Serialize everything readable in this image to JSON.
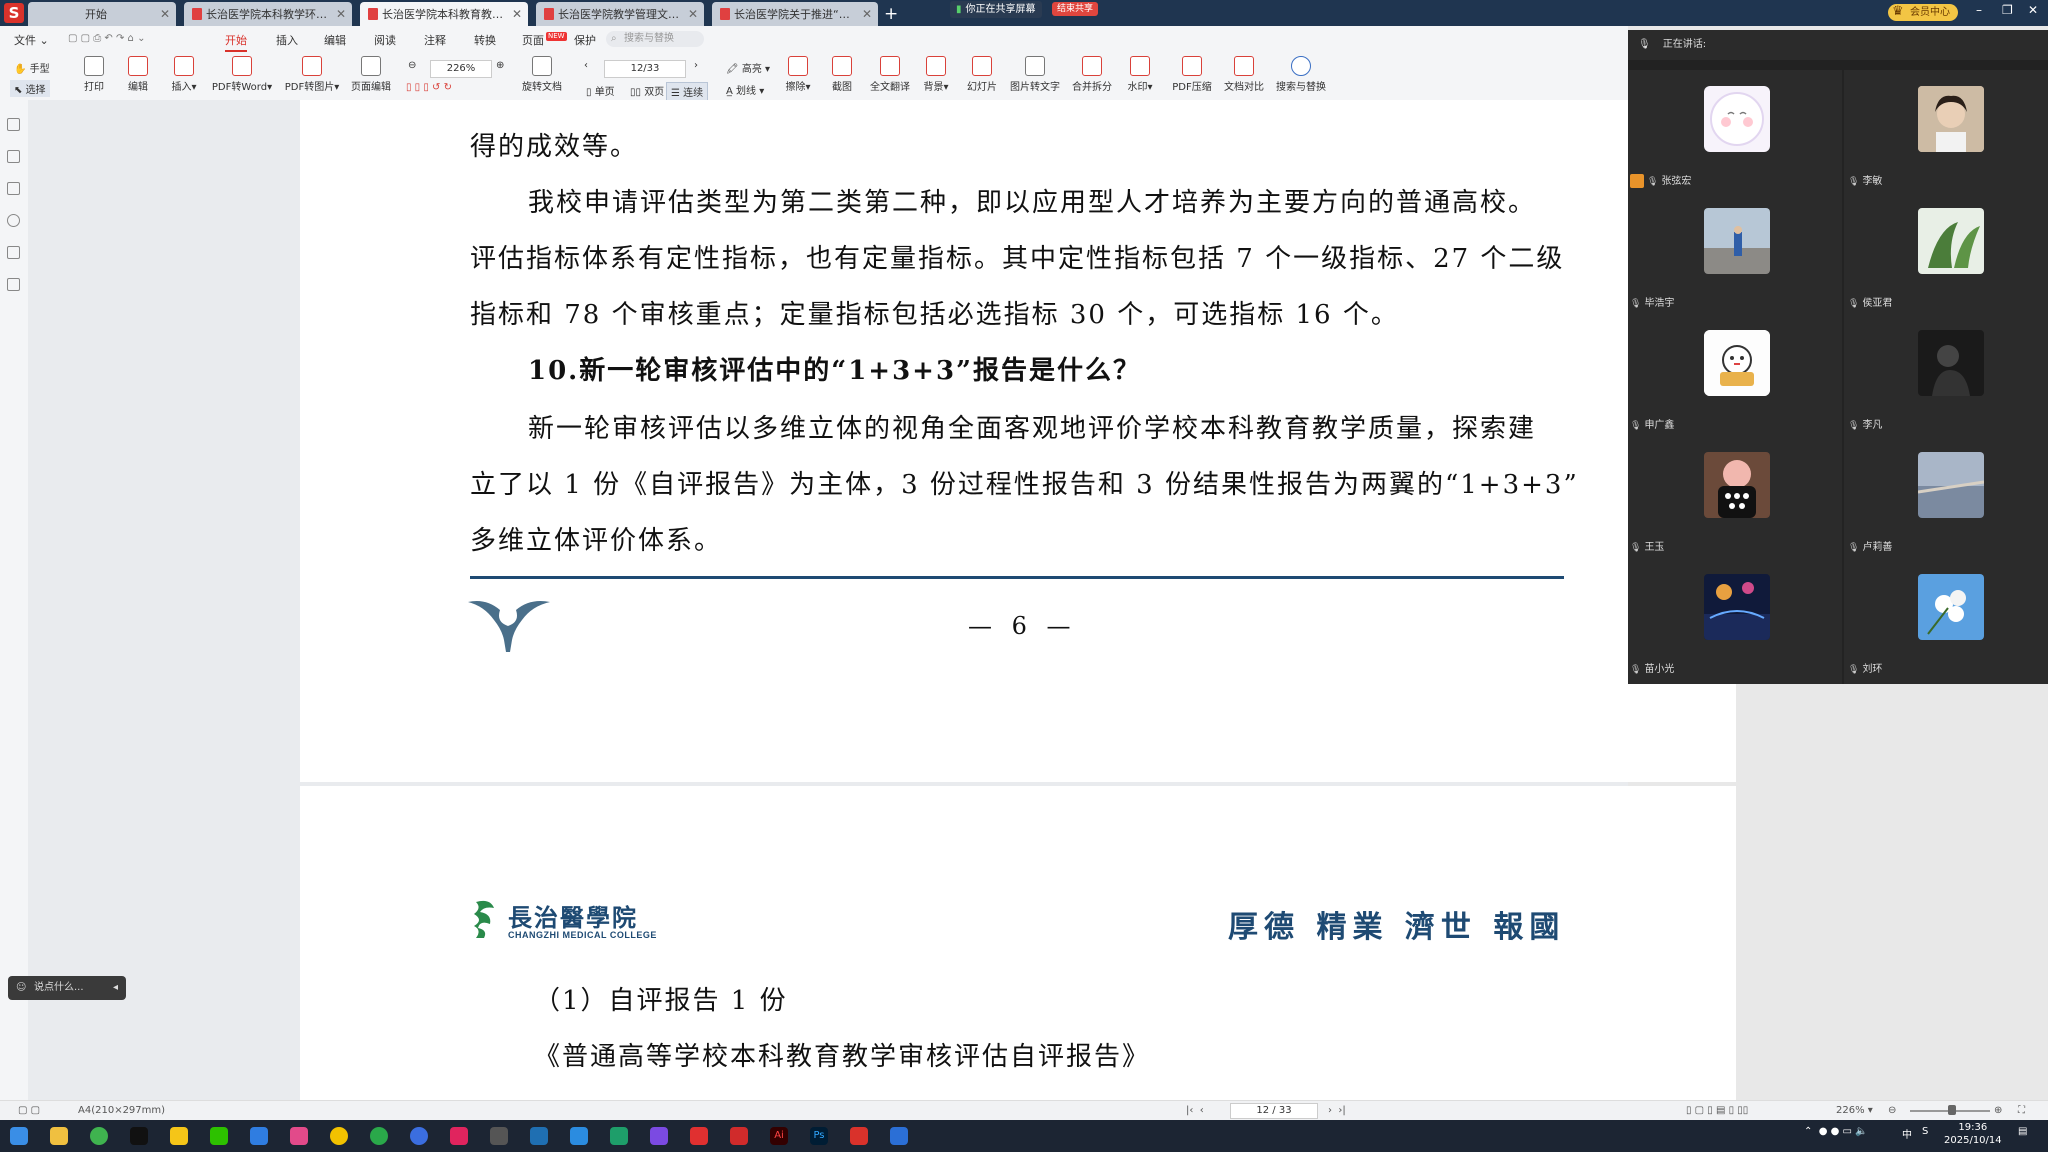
{
  "tabs": [
    {
      "label": "开始",
      "active": false
    },
    {
      "label": "长治医学院本科教学环节质量...",
      "active": false
    },
    {
      "label": "长治医学院本科教育教学审核...",
      "active": true
    },
    {
      "label": "长治医学院教学管理文件汇编...",
      "active": false
    },
    {
      "label": "长治医学院关于推进“总体因...",
      "active": false
    }
  ],
  "share": {
    "status": "你正在共享屏幕",
    "stop_label": "结束共享"
  },
  "member_center": "会员中心",
  "menu": {
    "file": "文件",
    "items": [
      "开始",
      "插入",
      "编辑",
      "阅读",
      "注释",
      "转换",
      "页面",
      "保护"
    ],
    "active": "开始",
    "new_badge": "NEW",
    "search_placeholder": "搜索与替换"
  },
  "ribbon": {
    "hand": "手型",
    "select": "选择",
    "buttons": [
      "打印",
      "编辑",
      "插入",
      "PDF转Word",
      "PDF转图片",
      "页面编辑"
    ],
    "zoom": "226%",
    "page": "12/33",
    "rotate": "旋转文档",
    "single": "单页",
    "double": "双页",
    "continuous": "连续",
    "highlight": "高亮",
    "underline": "划线",
    "tools": [
      "擦除",
      "截图",
      "全文翻译",
      "背景",
      "幻灯片",
      "图片转文字",
      "合并拆分",
      "水印",
      "PDF压缩",
      "文档对比",
      "搜索与替换"
    ]
  },
  "document": {
    "page1_lines": [
      {
        "text": "得的成效等。",
        "bold": false,
        "indent": false
      },
      {
        "text": "我校申请评估类型为第二类第二种，即以应用型人才培养为主要方向的普通高校。",
        "bold": false,
        "indent": true
      },
      {
        "text": "评估指标体系有定性指标，也有定量指标。其中定性指标包括 7 个一级指标、27 个二级",
        "bold": false,
        "indent": false
      },
      {
        "text": "指标和 78 个审核重点；定量指标包括必选指标 30 个，可选指标 16 个。",
        "bold": false,
        "indent": false
      },
      {
        "text": "10.新一轮审核评估中的“1+3+3”报告是什么？",
        "bold": true,
        "indent": true
      },
      {
        "text": "新一轮审核评估以多维立体的视角全面客观地评价学校本科教育教学质量，探索建",
        "bold": false,
        "indent": true
      },
      {
        "text": "立了以 1 份《自评报告》为主体，3 份过程性报告和 3 份结果性报告为两翼的“1+3+3”",
        "bold": false,
        "indent": false
      },
      {
        "text": "多维立体评价体系。",
        "bold": false,
        "indent": false
      }
    ],
    "page_number": "— 6 —",
    "school_name": "長治醫學院",
    "school_name_en": "CHANGZHI MEDICAL COLLEGE",
    "motto": "厚德 精業 濟世 報國",
    "page2_lines": [
      {
        "text": "（1）自评报告 1 份",
        "indent": true
      },
      {
        "text": "《普通高等学校本科教育教学审核评估自评报告》",
        "indent": true
      }
    ]
  },
  "meeting": {
    "speaking_label": "正在讲话:",
    "participants": [
      {
        "name": "张弦宏",
        "speaking": true
      },
      {
        "name": "李敏",
        "speaking": false
      },
      {
        "name": "毕浩宇",
        "speaking": false
      },
      {
        "name": "侯亚君",
        "speaking": false
      },
      {
        "name": "申广鑫",
        "speaking": false
      },
      {
        "name": "李凡",
        "speaking": false
      },
      {
        "name": "王玉",
        "speaking": false
      },
      {
        "name": "卢莉善",
        "speaking": false
      },
      {
        "name": "苗小光",
        "speaking": false
      },
      {
        "name": "刘环",
        "speaking": false
      }
    ]
  },
  "chat_placeholder": "说点什么...",
  "status": {
    "page_size": "A4(210×297mm)",
    "page": "12 / 33",
    "zoom": "226%"
  },
  "clock": {
    "time": "19:36",
    "date": "2025/10/14"
  },
  "ime": "中",
  "colors": {
    "accent": "#d9322b",
    "doc_blue": "#1e4a73",
    "tabbar": "#1f3550"
  }
}
